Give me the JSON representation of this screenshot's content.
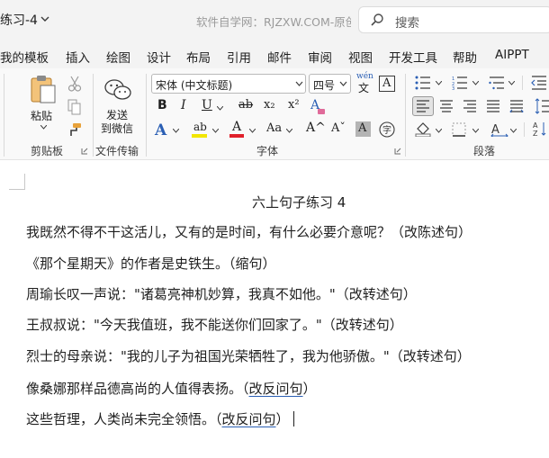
{
  "window": {
    "doc_title": "练习-4",
    "watermark": "软件自学网：RJZXW.COM-原创",
    "search_label": "搜索"
  },
  "tabs": [
    "我的模板",
    "插入",
    "绘图",
    "设计",
    "布局",
    "引用",
    "邮件",
    "审阅",
    "视图",
    "开发工具",
    "帮助",
    "AIPPT"
  ],
  "ribbon": {
    "clipboard": {
      "paste_label": "粘贴",
      "group_label": "剪贴板"
    },
    "transfer": {
      "send_label_1": "发送",
      "send_label_2": "到微信",
      "group_label": "文件传输"
    },
    "font": {
      "font_name": "宋体 (中文标题)",
      "font_size": "四号",
      "pinyin_glyph": "wén",
      "border_glyph": "A",
      "bold": "B",
      "italic": "I",
      "underline": "U",
      "strike": "ab",
      "subscript": "x₂",
      "superscript": "x²",
      "clear_format": "A",
      "text_effect": "A",
      "highlight": "ab",
      "font_color": "A",
      "change_case": "Aa",
      "grow": "A^",
      "shrink": "Aˇ",
      "char_shading": "A",
      "enclose": "字",
      "group_label": "字体"
    },
    "paragraph": {
      "group_label": "段落"
    },
    "colors": {
      "highlight": "#f2e600",
      "font_color": "#e0202a",
      "accent": "#2b5fb4"
    }
  },
  "document": {
    "heading": "六上句子练习 4",
    "lines": [
      "我既然不得不干这活儿，又有的是时间，有什么必要介意呢？（改陈述句）",
      "《那个星期天》的作者是史铁生。（缩句）",
      "周瑜长叹一声说：\"诸葛亮神机妙算，我真不如他。\"（改转述句）",
      "王叔叔说：\"今天我值班，我不能送你们回家了。\"（改转述句）",
      "烈士的母亲说：\"我的儿子为祖国光荣牺牲了，我为他骄傲。\"（改转述句）"
    ],
    "line6_main": "像桑娜那样品德高尚的人值得表扬。（",
    "line6_flag": "改反问句",
    "line6_end": "）",
    "line7_main": "这些哲理，人类尚未完全领悟。（",
    "line7_flag": "改反问句",
    "line7_end": "）"
  }
}
